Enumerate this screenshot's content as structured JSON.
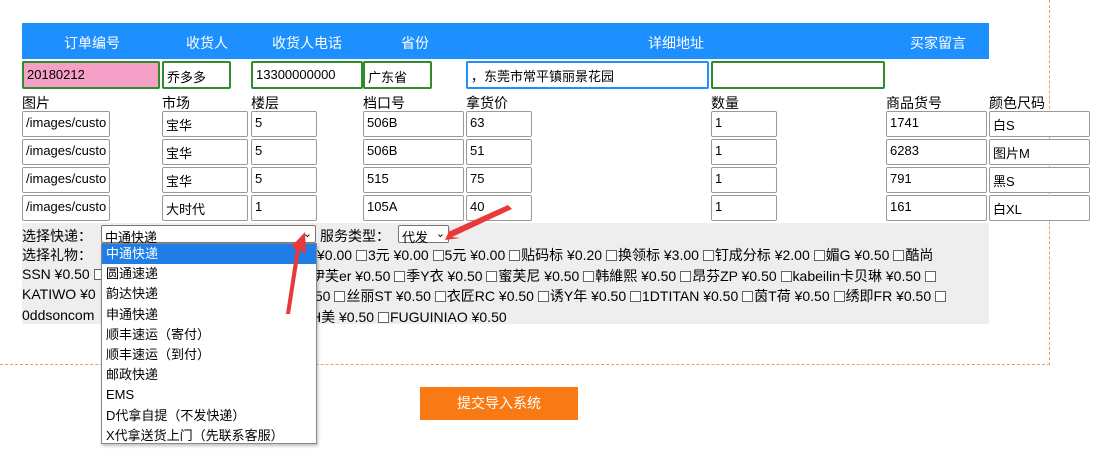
{
  "header": [
    "订单编号",
    "收货人",
    "收货人电话",
    "省份",
    "详细地址",
    "买家留言"
  ],
  "order": {
    "id": "20180212",
    "receiver": "乔多多",
    "phone": "13300000000",
    "province": "广东省",
    "address": "，东莞市常平镇丽景花园",
    "note": ""
  },
  "item_headers": [
    "图片",
    "市场",
    "楼层",
    "档口号",
    "拿货价",
    "数量",
    "商品货号",
    "颜色尺码"
  ],
  "rows": [
    [
      "/images/custo",
      "宝华",
      "5",
      "506B",
      "63",
      "1",
      "1741",
      "白S"
    ],
    [
      "/images/custo",
      "宝华",
      "5",
      "506B",
      "51",
      "1",
      "6283",
      "图片M"
    ],
    [
      "/images/custo",
      "宝华",
      "5",
      "515",
      "75",
      "1",
      "791",
      "黑S"
    ],
    [
      "/images/custo",
      "大时代",
      "1",
      "105A",
      "40",
      "1",
      "161",
      "白XL"
    ]
  ],
  "express": {
    "label": "选择快递：",
    "selected": "中通快递",
    "options": [
      "中通快递",
      "圆通速递",
      "韵达快递",
      "申通快递",
      "顺丰速运（寄付）",
      "顺丰速运（到付）",
      "邮政快递",
      "EMS",
      "D代拿自提（不发快递）",
      "X代拿送货上门（先联系客服）"
    ]
  },
  "service": {
    "label": "服务类型：",
    "selected": "代发"
  },
  "gift": {
    "label": "选择礼物：",
    "line1_visible": "¥0.00 ▢3元 ¥0.00 ▢5元 ¥0.00 ▢贴码标 ¥0.20 ▢换领标 ¥3.00 ▢钉成分标 ¥2.00 ▢媚G ¥0.50 ▢酷尚",
    "line2_left": "SSN ¥0.50 ▢",
    "line2_right": "伊芙er ¥0.50 ▢季Y衣 ¥0.50 ▢蜜芙尼 ¥0.50 ▢韩維熙 ¥0.50 ▢昂芬ZP ¥0.50 ▢kabeilin卡贝琳 ¥0.50 ▢",
    "line3_left": "KATIWO ¥0",
    "line3_right": ".50 ▢丝丽ST ¥0.50 ▢衣匠RC ¥0.50 ▢诱Y年 ¥0.50 ▢1DTITAN ¥0.50 ▢茵T荷 ¥0.50 ▢绣即FR ¥0.50 ▢",
    "line4_left": "0ddsoncom",
    "line4_right": "H美 ¥0.50 ▢FUGUINIAO ¥0.50"
  },
  "submit_label": "提交导入系统",
  "colors": {
    "header": "#1e8fff",
    "submit": "#f97a14",
    "highlight": "#f6a0c8",
    "arrow": "#e83a3a"
  }
}
